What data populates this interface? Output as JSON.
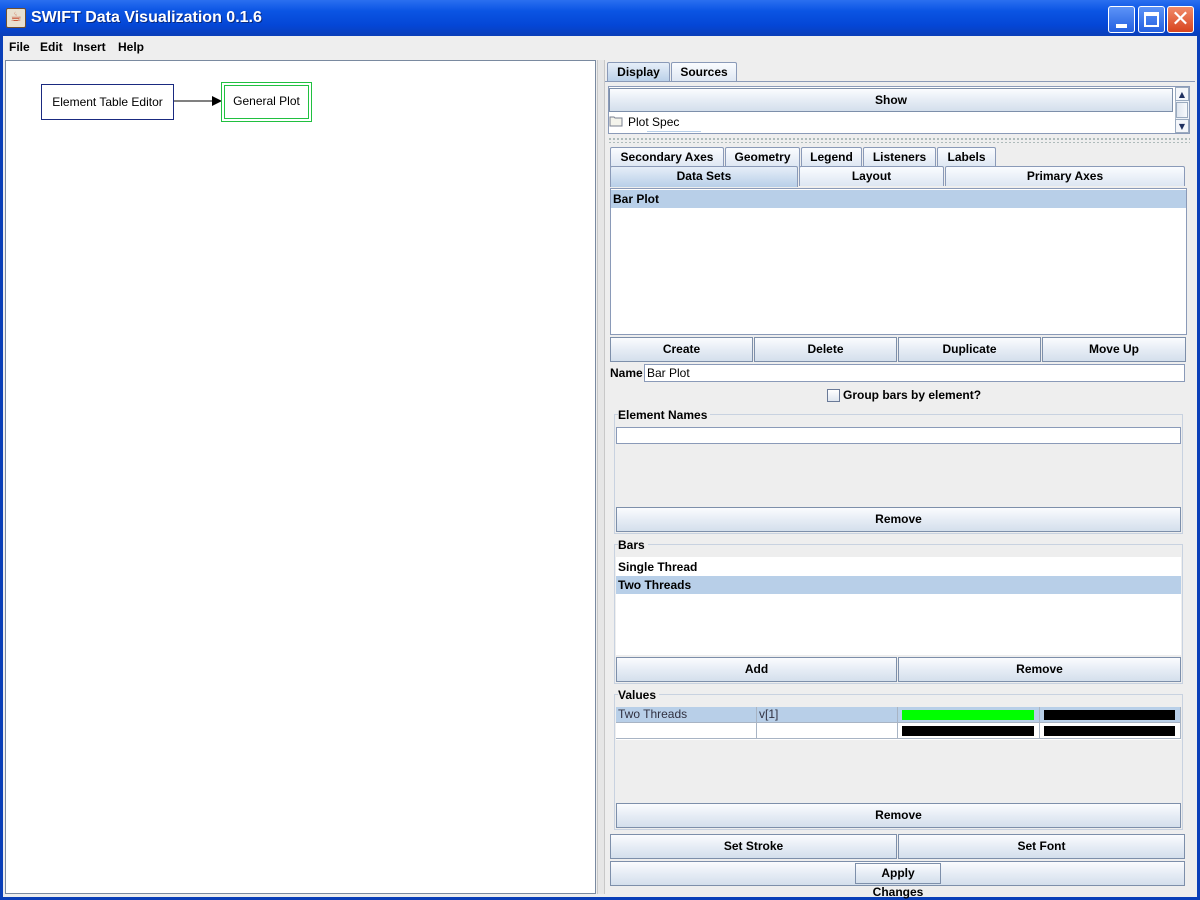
{
  "window": {
    "title": "SWIFT Data Visualization 0.1.6",
    "icon": "java-cup-icon"
  },
  "menu": [
    {
      "label": "File"
    },
    {
      "label": "Edit"
    },
    {
      "label": "Insert"
    },
    {
      "label": "Help"
    }
  ],
  "graph": {
    "nodes": [
      {
        "label": "Element Table Editor"
      },
      {
        "label": "General Plot"
      }
    ]
  },
  "top_tabs": {
    "display": "Display",
    "sources": "Sources"
  },
  "tree": {
    "show_button": "Show",
    "item": "Plot Spec"
  },
  "config_tabs": {
    "row1": [
      "Secondary Axes",
      "Geometry",
      "Legend",
      "Listeners",
      "Labels"
    ],
    "row2": [
      "Data Sets",
      "Layout",
      "Primary Axes"
    ]
  },
  "datasets": {
    "items": [
      "Bar Plot"
    ],
    "buttons": {
      "create": "Create",
      "delete": "Delete",
      "duplicate": "Duplicate",
      "move_up": "Move Up"
    },
    "name_label": "Name",
    "name_value": "Bar Plot",
    "group_checkbox": "Group bars by element?"
  },
  "element_names": {
    "title": "Element Names",
    "remove": "Remove"
  },
  "bars": {
    "title": "Bars",
    "items": [
      "Single Thread",
      "Two Threads"
    ],
    "add": "Add",
    "remove": "Remove"
  },
  "values": {
    "title": "Values",
    "rows": [
      {
        "name": "Two Threads",
        "var": "v[1]",
        "fill": "#00ff00",
        "stroke": "#000000"
      },
      {
        "name": "",
        "var": "",
        "fill": "#000000",
        "stroke": "#000000"
      }
    ],
    "remove": "Remove"
  },
  "footer": {
    "set_stroke": "Set Stroke",
    "set_font": "Set Font",
    "apply": "Apply Changes"
  }
}
